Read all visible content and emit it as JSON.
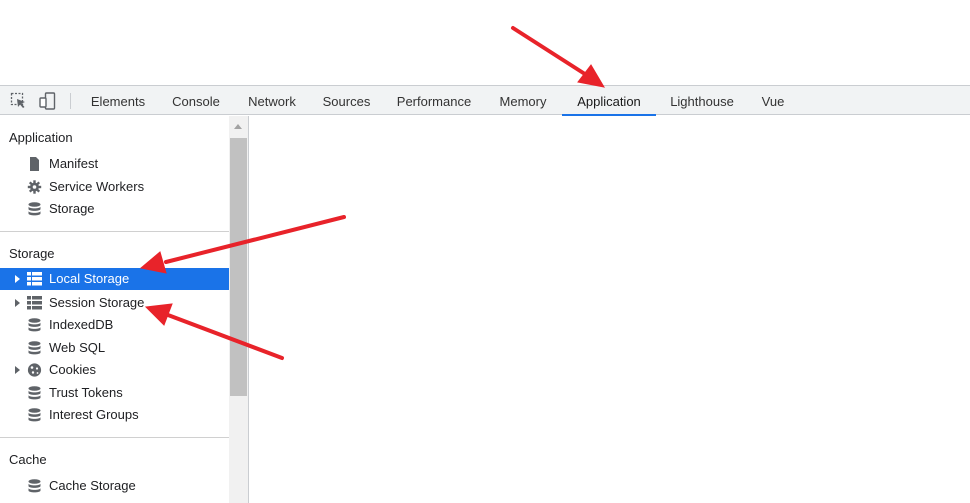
{
  "toolbar": {
    "inspect_icon": "inspect-element-icon",
    "device_icon": "device-toolbar-icon",
    "tabs": [
      {
        "label": "Elements"
      },
      {
        "label": "Console"
      },
      {
        "label": "Network"
      },
      {
        "label": "Sources"
      },
      {
        "label": "Performance"
      },
      {
        "label": "Memory"
      },
      {
        "label": "Application",
        "active": true
      },
      {
        "label": "Lighthouse"
      },
      {
        "label": "Vue"
      }
    ]
  },
  "sidebar": {
    "application": {
      "title": "Application",
      "items": [
        {
          "label": "Manifest",
          "icon": "file-icon"
        },
        {
          "label": "Service Workers",
          "icon": "gear-icon"
        },
        {
          "label": "Storage",
          "icon": "database-icon"
        }
      ]
    },
    "storage": {
      "title": "Storage",
      "items": [
        {
          "label": "Local Storage",
          "icon": "table-grid-icon",
          "expandable": true,
          "selected": true
        },
        {
          "label": "Session Storage",
          "icon": "table-grid-icon",
          "expandable": true
        },
        {
          "label": "IndexedDB",
          "icon": "database-icon"
        },
        {
          "label": "Web SQL",
          "icon": "database-icon"
        },
        {
          "label": "Cookies",
          "icon": "cookie-icon",
          "expandable": true
        },
        {
          "label": "Trust Tokens",
          "icon": "database-icon"
        },
        {
          "label": "Interest Groups",
          "icon": "database-icon"
        }
      ]
    },
    "cache": {
      "title": "Cache",
      "items": [
        {
          "label": "Cache Storage",
          "icon": "database-icon"
        }
      ]
    }
  },
  "colors": {
    "accent": "#1a73e8",
    "selected_bg": "#1a73e8",
    "annotation_arrow": "#e8232a",
    "toolbar_bg": "#f1f3f4"
  }
}
